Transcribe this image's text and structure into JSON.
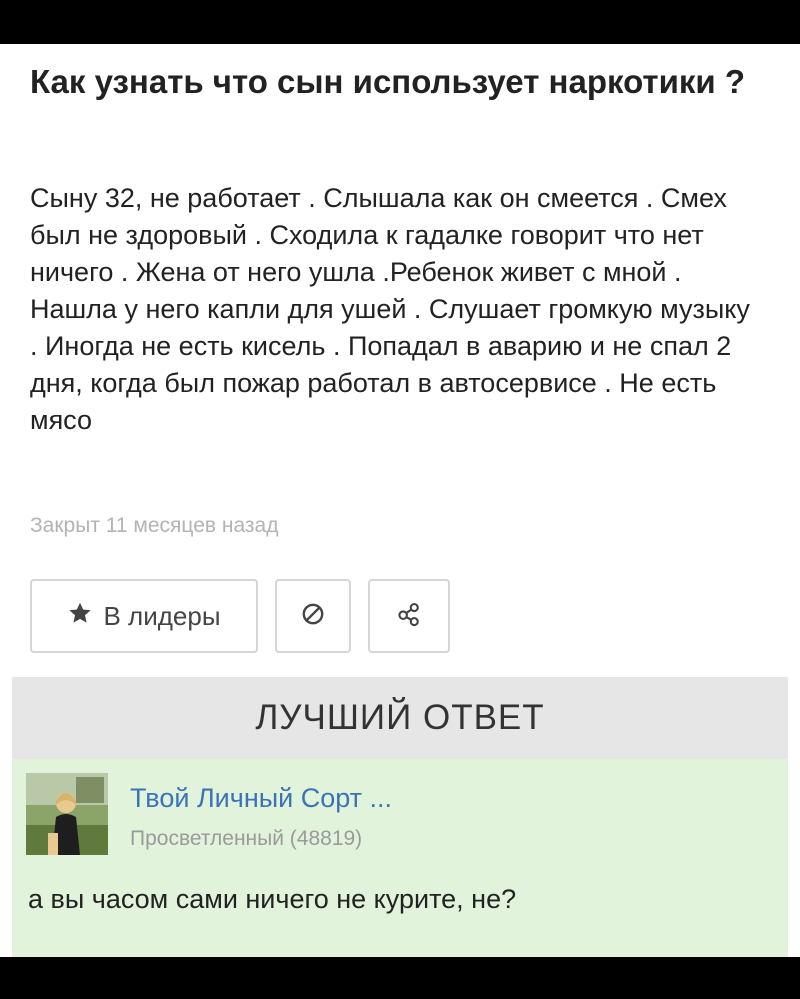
{
  "question": {
    "title": "Как узнать что сын использует наркотики ?",
    "body": "Сыну 32, не работает . Слышала как он смеется . Смех был не здоровый . Сходила к гадалке говорит что нет ничего . Жена от него ушла .Ребенок живет с мной . Нашла у него капли для ушей . Слушает громкую музыку . Иногда не есть кисель . Попадал в аварию и не спал 2 дня, когда был пожар работал в автосервисе . Не есть мясо",
    "meta": "Закрыт 11 месяцев назад"
  },
  "actions": {
    "leaders_icon": "star-icon",
    "leaders_label": "В лидеры",
    "report_icon": "block-icon",
    "share_icon": "share-icon"
  },
  "best_answer": {
    "header": "ЛУЧШИЙ ОТВЕТ",
    "author": "Твой Личный Сорт ...",
    "rank": "Просветленный (48819)",
    "text": "а вы часом сами ничего не курите, не?"
  },
  "colors": {
    "author_link": "#3a73b8",
    "answer_bg": "#e2f3dc",
    "header_bg": "#e6e6e6",
    "meta_text": "#b3b3b3"
  }
}
